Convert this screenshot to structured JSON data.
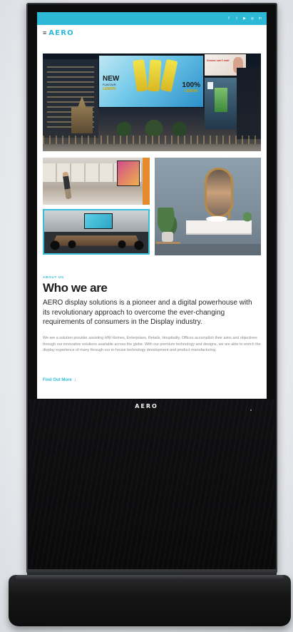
{
  "brand": {
    "name": "AERO",
    "accent": "#2db9d6"
  },
  "kiosk": {
    "logo": "AERO",
    "frame_color": "#0c0c0d"
  },
  "screen": {
    "social_icons": [
      "facebook-icon",
      "twitter-icon",
      "youtube-icon",
      "instagram-icon",
      "linkedin-icon"
    ],
    "social_glyphs": [
      "f",
      "t",
      "▶",
      "◎",
      "in"
    ],
    "menu_glyph": "≡",
    "hero": {
      "ad_new": "NEW",
      "ad_flavour": "FLAVOUR",
      "ad_lemon": "LEMON",
      "ad_pct": "100%",
      "ad_lemon2": "LEMON",
      "ad_small": "Drama can't wait"
    },
    "eyebrow": "ABOUT US",
    "title": "Who we are",
    "lead": "AERO display solutions is a pioneer and a digital powerhouse with its revolutionary approach to overcome the ever-changing requirements of consumers in the Display industry.",
    "body": "We are a solution provider assisting HNI Homes, Enterprises, Retails, Hospitality, Offices accomplish their aims and objectives through our innovative solutions available across the globe. With our premium technology and designs, we are able to enrich the display experience of many through our in-house technology development and product manufacturing.",
    "cta": {
      "label": "Find Out More",
      "arrow": "↓"
    }
  }
}
